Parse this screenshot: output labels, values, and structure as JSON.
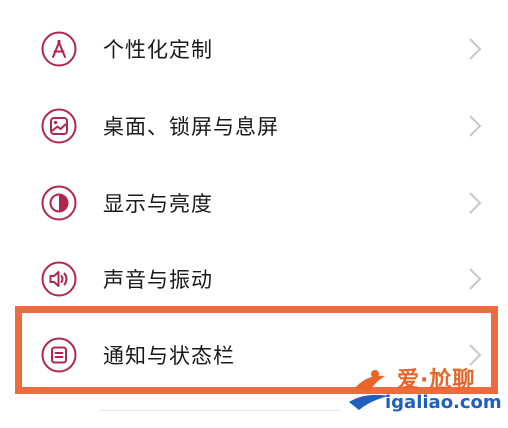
{
  "colors": {
    "icon_accent": "#b0264f",
    "chevron": "#c8c8c8",
    "highlight": "#ee6b3f",
    "watermark_title": "#e8652a",
    "watermark_url": "#1f5fbf"
  },
  "settings": {
    "items": [
      {
        "label": "个性化定制",
        "icon": "compass-icon"
      },
      {
        "label": "桌面、锁屏与息屏",
        "icon": "wallpaper-icon"
      },
      {
        "label": "显示与亮度",
        "icon": "brightness-icon"
      },
      {
        "label": "声音与振动",
        "icon": "speaker-icon"
      },
      {
        "label": "通知与状态栏",
        "icon": "notification-icon",
        "highlighted": true
      }
    ]
  },
  "watermark": {
    "title": "爱·尬聊",
    "url": "igaliao.com"
  }
}
